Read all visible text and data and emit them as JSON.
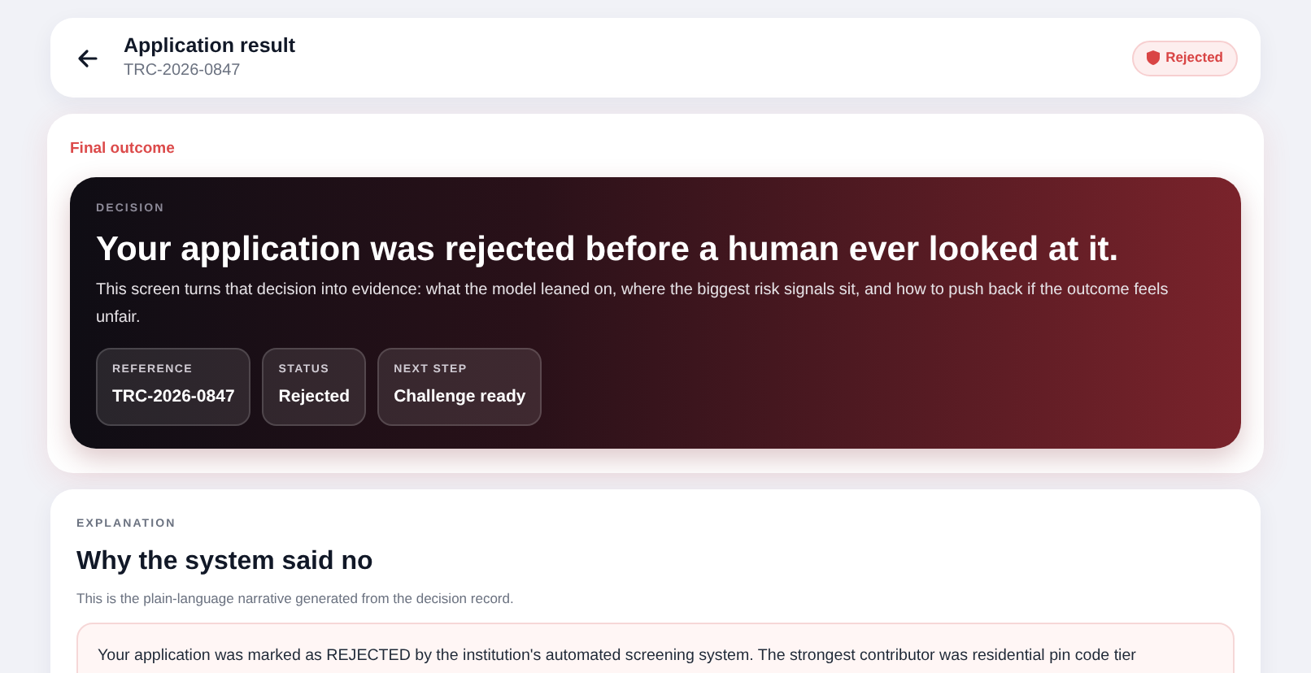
{
  "header": {
    "title": "Application result",
    "reference": "TRC-2026-0847",
    "status_badge": {
      "label": "Rejected",
      "kind": "rejected"
    }
  },
  "outcome": {
    "label": "Final outcome",
    "decision": {
      "eyebrow": "DECISION",
      "headline": "Your application was rejected before a human ever looked at it.",
      "summary": "This screen turns that decision into evidence: what the model leaned on, where the biggest risk signals sit, and how to push back if the outcome feels unfair.",
      "facts": [
        {
          "label": "REFERENCE",
          "value": "TRC-2026-0847"
        },
        {
          "label": "STATUS",
          "value": "Rejected"
        },
        {
          "label": "NEXT STEP",
          "value": "Challenge ready"
        }
      ]
    }
  },
  "explanation": {
    "eyebrow": "EXPLANATION",
    "title": "Why the system said no",
    "subtitle": "This is the plain-language narrative generated from the decision record.",
    "narrative": "Your application was marked as REJECTED by the institution's automated screening system. The strongest contributor was residential pin code tier"
  }
}
